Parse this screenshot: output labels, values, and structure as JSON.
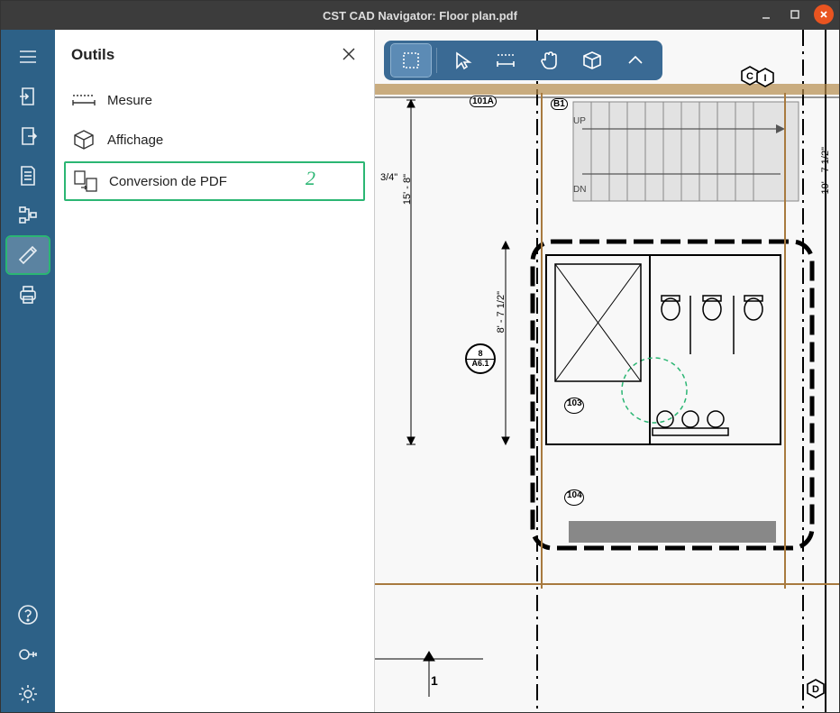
{
  "window": {
    "title": "CST CAD Navigator: Floor plan.pdf"
  },
  "panel": {
    "title": "Outils",
    "items": {
      "measure": "Mesure",
      "display": "Affichage",
      "pdfconv": "Conversion de PDF"
    }
  },
  "annotations": {
    "one": "1",
    "two": "2"
  },
  "drawing": {
    "dim1": "3/4\"",
    "dim2": "15' - 8\"",
    "dim3": "8' - 7 1/2\"",
    "dim4": "19' - 7 1/2\"",
    "up": "UP",
    "dn": "DN",
    "room101a": "101A",
    "roomB1": "B1",
    "roomC": "C",
    "roomI": "I",
    "roomD": "D",
    "room103": "103",
    "room104": "104",
    "floor1": "1",
    "detail_top": "8",
    "detail_bot": "A6.1"
  }
}
